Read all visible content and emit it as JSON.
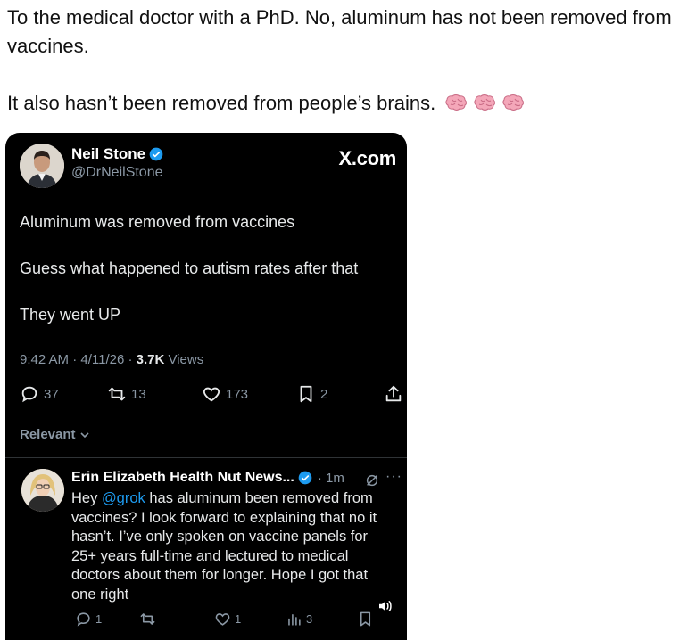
{
  "caption": {
    "line1": "To the medical doctor with a PhD. No, aluminum has not been removed from vaccines.",
    "line2": "It also hasn’t been removed from people’s brains.",
    "emoji_icons": [
      "brain-icon",
      "brain-icon",
      "brain-icon"
    ]
  },
  "tweet": {
    "author_name": "Neil Stone",
    "author_handle": "@DrNeilStone",
    "brand": "X.com",
    "lines": [
      "Aluminum was removed from vaccines",
      "Guess what happened to autism rates after that",
      "They went UP"
    ],
    "meta_time": "9:42 AM · 4/11/26 · ",
    "meta_views_count": "3.7K",
    "meta_views_label": " Views",
    "actions": {
      "replies": "37",
      "reposts": "13",
      "likes": "173",
      "bookmarks": "2"
    },
    "sort_label": "Relevant"
  },
  "reply": {
    "author_name": "Erin Elizabeth Health Nut News...",
    "time": "· 1m",
    "body_pre": "Hey ",
    "mention": "@grok",
    "body_post": " has aluminum been removed from vaccines? I look forward to explaining that no it hasn’t. I’ve only spoken on vaccine panels for 25+ years full-time and lectured to medical doctors about them for longer. Hope I got that one right",
    "actions": {
      "replies": "1",
      "likes": "1",
      "views": "3"
    }
  },
  "colors": {
    "background": "#000000",
    "accent": "#1d9bf0",
    "muted": "#8b98a5",
    "text": "#e7e9ea"
  }
}
